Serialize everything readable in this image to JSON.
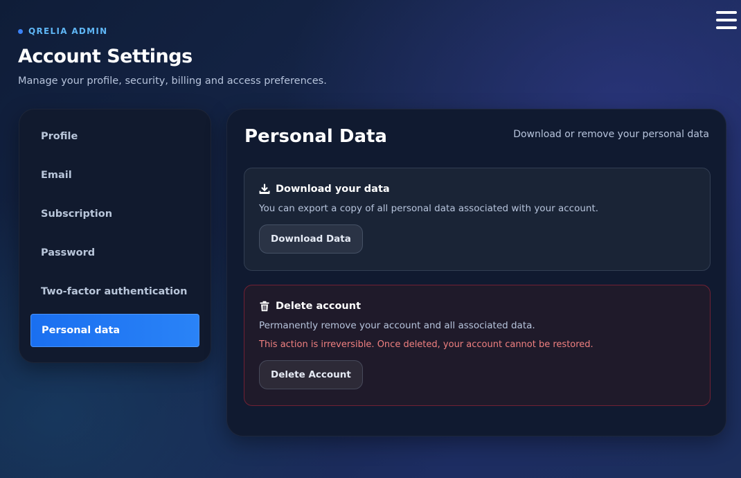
{
  "brand": {
    "name": "QRELIA ADMIN"
  },
  "header": {
    "title": "Account Settings",
    "subtitle": "Manage your profile, security, billing and access preferences."
  },
  "sidebar": {
    "items": [
      {
        "label": "Profile"
      },
      {
        "label": "Email"
      },
      {
        "label": "Subscription"
      },
      {
        "label": "Password"
      },
      {
        "label": "Two-factor authentication"
      },
      {
        "label": "Personal data",
        "active": true
      }
    ]
  },
  "panel": {
    "title": "Personal Data",
    "hint": "Download or remove your personal data",
    "download": {
      "icon": "download-icon",
      "title": "Download your data",
      "text": "You can export a copy of all personal data associated with your account.",
      "button": "Download Data"
    },
    "delete": {
      "icon": "trash-icon",
      "title": "Delete account",
      "text": "Permanently remove your account and all associated data.",
      "warning": "This action is irreversible. Once deleted, your account cannot be restored.",
      "button": "Delete Account"
    }
  },
  "colors": {
    "accent": "#2a83f7",
    "brand": "#5fb6f5",
    "danger": "#f08080"
  }
}
